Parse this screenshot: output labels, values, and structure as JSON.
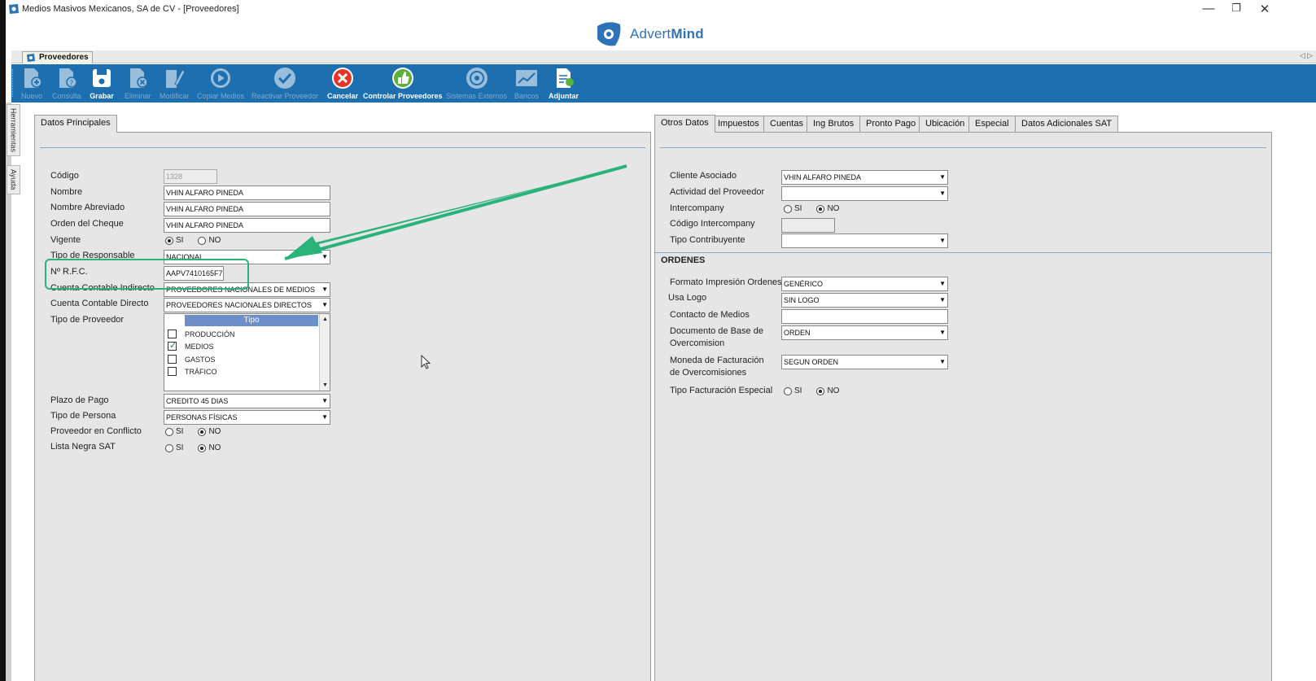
{
  "window": {
    "title": "Medios Masivos Mexicanos, SA de CV - [Proveedores]",
    "minimize": "—",
    "restore": "❐",
    "close": "✕"
  },
  "logo": {
    "part1": "Advert",
    "part2": "Mind"
  },
  "doc_tab": {
    "label": "Proveedores",
    "nav": "◁ ▷"
  },
  "toolbar": {
    "items": [
      {
        "label": "Nuevo",
        "icon": "new-doc-icon",
        "enabled": false
      },
      {
        "label": "Consulta",
        "icon": "query-doc-icon",
        "enabled": false
      },
      {
        "label": "Grabar",
        "icon": "save-disk-icon",
        "enabled": true
      },
      {
        "label": "Eliminar",
        "icon": "delete-doc-icon",
        "enabled": false
      },
      {
        "label": "Modificar",
        "icon": "edit-doc-icon",
        "enabled": false
      },
      {
        "label": "Copiar Medios",
        "icon": "copy-play-icon",
        "enabled": false
      },
      {
        "label": "Reactivar Proveedor",
        "icon": "check-circle-icon",
        "enabled": false
      },
      {
        "label": "Cancelar",
        "icon": "cancel-circle-icon",
        "enabled": true
      },
      {
        "label": "Controlar Proveedores",
        "icon": "control-thumb-icon",
        "enabled": true
      },
      {
        "label": "Sistemas Externos",
        "icon": "external-systems-icon",
        "enabled": false
      },
      {
        "label": "Bancos",
        "icon": "chart-line-icon",
        "enabled": false
      },
      {
        "label": "Adjuntar",
        "icon": "attach-doc-icon",
        "enabled": true
      }
    ]
  },
  "side_tabs": {
    "tools": "Herramientas",
    "help": "Ayuda"
  },
  "left_panel": {
    "tab": "Datos Principales",
    "fields": {
      "codigo": {
        "label": "Código",
        "value": "1328"
      },
      "nombre": {
        "label": "Nombre",
        "value": "VHIN ALFARO PINEDA"
      },
      "nombre_abreviado": {
        "label": "Nombre Abreviado",
        "value": "VHIN ALFARO PINEDA"
      },
      "orden_cheque": {
        "label": "Orden del Cheque",
        "value": "VHIN ALFARO PINEDA"
      },
      "vigente": {
        "label": "Vigente",
        "opt_si": "SI",
        "opt_no": "NO",
        "selected": "SI"
      },
      "tipo_responsable": {
        "label": "Tipo de Responsable",
        "value": "NACIONAL"
      },
      "rfc": {
        "label": "Nº R.F.C.",
        "value": "AAPV7410165F7"
      },
      "cuenta_indirecto": {
        "label": "Cuenta Contable Indirecto",
        "value": "PROVEEDORES NACIONALES DE MEDIOS"
      },
      "cuenta_directo": {
        "label": "Cuenta Contable Directo",
        "value": "PROVEEDORES NACIONALES DIRECTOS"
      },
      "tipo_proveedor": {
        "label": "Tipo de Proveedor",
        "header": "Tipo",
        "items": [
          {
            "label": "PRODUCCIÓN",
            "checked": false
          },
          {
            "label": "MEDIOS",
            "checked": true
          },
          {
            "label": "GASTOS",
            "checked": false
          },
          {
            "label": "TRÁFICO",
            "checked": false
          }
        ]
      },
      "plazo_pago": {
        "label": "Plazo de Pago",
        "value": "CREDITO 45 DIAS"
      },
      "tipo_persona": {
        "label": "Tipo de Persona",
        "value": "PERSONAS FÍSICAS"
      },
      "conflicto": {
        "label": "Proveedor en Conflicto",
        "opt_si": "SI",
        "opt_no": "NO",
        "selected": "NO"
      },
      "lista_negra": {
        "label": "Lista Negra SAT",
        "opt_si": "SI",
        "opt_no": "NO",
        "selected": "NO"
      }
    }
  },
  "right_panel": {
    "tabs": [
      "Otros Datos",
      "Impuestos",
      "Cuentas",
      "Ing Brutos",
      "Pronto Pago",
      "Ubicación",
      "Especial",
      "Datos Adicionales SAT"
    ],
    "active_tab": "Otros Datos",
    "fields": {
      "cliente_asociado": {
        "label": "Cliente Asociado",
        "value": "VHIN ALFARO PINEDA"
      },
      "actividad": {
        "label": "Actividad del Proveedor",
        "value": ""
      },
      "intercompany": {
        "label": "Intercompany",
        "opt_si": "SI",
        "opt_no": "NO",
        "selected": "NO"
      },
      "codigo_intercompany": {
        "label": "Código Intercompany",
        "value": ""
      },
      "tipo_contribuyente": {
        "label": "Tipo Contribuyente",
        "value": ""
      }
    },
    "ordenes": {
      "title": "ORDENES",
      "formato": {
        "label": "Formato Impresión Ordenes",
        "value": "GENÉRICO"
      },
      "usa_logo": {
        "label": "Usa Logo",
        "value": "SIN LOGO"
      },
      "contacto": {
        "label": "Contacto de Medios",
        "value": ""
      },
      "documento_base": {
        "label_1": "Documento de Base de",
        "label_2": "Overcomision",
        "value": "ORDEN"
      },
      "moneda": {
        "label_1": "Moneda de Facturación",
        "label_2": "de Overcomisiones",
        "value": "SEGUN ORDEN"
      },
      "tipo_facturacion": {
        "label": "Tipo Facturación Especial",
        "opt_si": "SI",
        "opt_no": "NO",
        "selected": "NO"
      }
    }
  },
  "colors": {
    "toolbar_bg": "#1e6fb0",
    "annotation": "#2ab27b",
    "panel_bg": "#e6e6e6",
    "brand": "#2e73b8"
  }
}
